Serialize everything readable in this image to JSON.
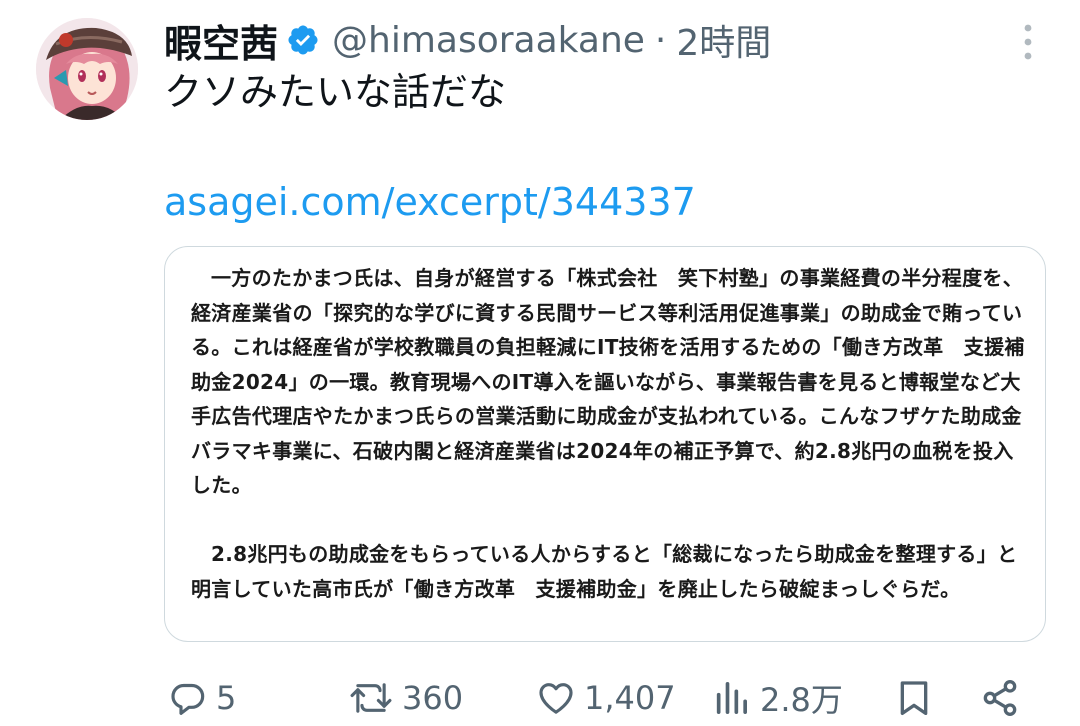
{
  "tweet": {
    "author": {
      "display_name": "暇空茜",
      "handle": "@himasoraakane",
      "verified": true,
      "avatar_icon": "avatar-illustration"
    },
    "separator": "·",
    "time": "2時間",
    "text": "クソみたいな話だな",
    "link": "asagei.com/excerpt/344337",
    "card": {
      "paragraphs": [
        "一方のたかまつ氏は、自身が経営する「株式会社　笑下村塾」の事業経費の半分程度を、経済産業省の「探究的な学びに資する民間サービス等利活用促進事業」の助成金で賄っている。これは経産省が学校教職員の負担軽減にIT技術を活用するための「働き方改革　支援補助金2024」の一環。教育現場へのIT導入を謳いながら、事業報告書を見ると博報堂など大手広告代理店やたかまつ氏らの営業活動に助成金が支払われている。こんなフザケた助成金バラマキ事業に、石破内閣と経済産業省は2024年の補正予算で、約2.8兆円の血税を投入した。",
        "2.8兆円もの助成金をもらっている人からすると「総裁になったら助成金を整理する」と明言していた高市氏が「働き方改革　支援補助金」を廃止したら破綻まっしぐらだ。"
      ]
    },
    "actions": {
      "replies": "5",
      "retweets": "360",
      "likes": "1,407",
      "views": "2.8万"
    }
  },
  "colors": {
    "link": "#1d9bf0",
    "secondary_text": "#536471",
    "verified_badge": "#1d9bf0",
    "card_border": "#cfd9de"
  },
  "icons": {
    "more": "more-vertical-icon",
    "reply": "reply-icon",
    "retweet": "retweet-icon",
    "like": "heart-icon",
    "views": "views-bar-icon",
    "bookmark": "bookmark-icon",
    "share": "share-icon"
  }
}
